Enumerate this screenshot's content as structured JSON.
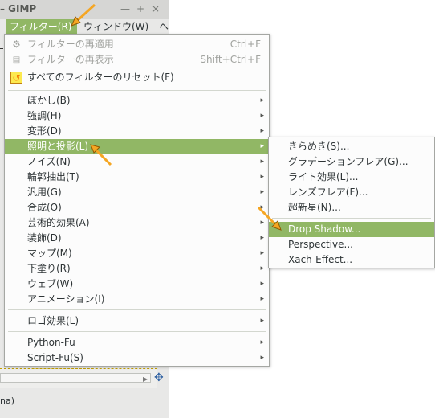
{
  "window": {
    "title": "– GIMP",
    "minimize_glyph": "—",
    "maximize_glyph": "+",
    "close_glyph": "×"
  },
  "menubar": {
    "filters": "フィルター(R)",
    "windows": "ウィンドウ(W)",
    "more": "ヘ"
  },
  "filters_menu": {
    "repeat": {
      "label": "フィルターの再適用",
      "shortcut": "Ctrl+F",
      "icon": "gear-icon"
    },
    "reshow": {
      "label": "フィルターの再表示",
      "shortcut": "Shift+Ctrl+F",
      "icon": "history-icon"
    },
    "reset": {
      "label": "すべてのフィルターのリセット(F)",
      "icon": "reset-icon"
    },
    "items": [
      "ぼかし(B)",
      "強調(H)",
      "変形(D)",
      "照明と投影(L)",
      "ノイズ(N)",
      "輪郭抽出(T)",
      "汎用(G)",
      "合成(O)",
      "芸術的効果(A)",
      "装飾(D)",
      "マップ(M)",
      "下塗り(R)",
      "ウェブ(W)",
      "アニメーション(I)"
    ],
    "logo": "ロゴ効果(L)",
    "python": "Python-Fu",
    "script": "Script-Fu(S)"
  },
  "light_submenu": {
    "items": [
      "きらめき(S)...",
      "グラデーションフレア(G)...",
      "ライト効果(L)...",
      "レンズフレア(F)...",
      "超新星(N)..."
    ],
    "drop_shadow": "Drop Shadow...",
    "perspective": "Perspective...",
    "xach": "Xach-Effect..."
  },
  "status": {
    "text": "na)"
  },
  "colors": {
    "highlight": "#91b765",
    "arrow": "#f5a623"
  }
}
